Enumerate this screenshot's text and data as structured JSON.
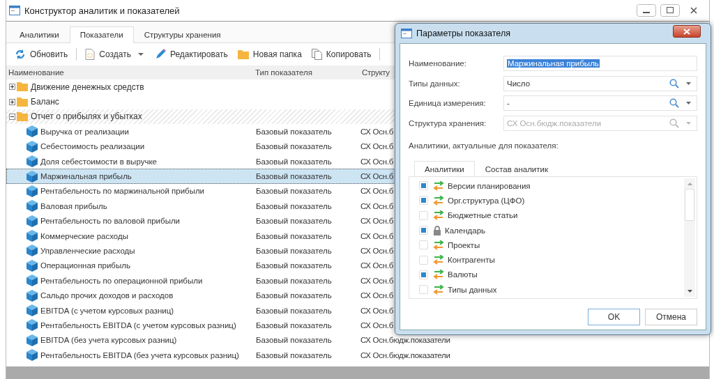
{
  "window": {
    "title": "Конструктор аналитик и показателей"
  },
  "tabs": [
    {
      "label": "Аналитики",
      "selected": false
    },
    {
      "label": "Показатели",
      "selected": true
    },
    {
      "label": "Структуры хранения",
      "selected": false
    }
  ],
  "toolbar": [
    {
      "kind": "refresh",
      "label": "Обновить"
    },
    {
      "kind": "create",
      "label": "Создать"
    },
    {
      "kind": "edit",
      "label": "Редактировать"
    },
    {
      "kind": "folder",
      "label": "Новая папка"
    },
    {
      "kind": "copy",
      "label": "Копировать"
    }
  ],
  "table": {
    "columns": [
      "Наименование",
      "Тип показателя",
      "Структу"
    ],
    "rows": [
      {
        "name": "Движение денежных средств",
        "expanded": false,
        "children": []
      },
      {
        "name": "Баланс",
        "expanded": false,
        "children": []
      },
      {
        "name": "Отчет о прибылях и убытках",
        "expanded": true,
        "children": [
          {
            "name": "Выручка от реализации",
            "type": "Базовый показатель",
            "structure": "СХ Осн.б",
            "selected": false
          },
          {
            "name": "Себестоимость реализации",
            "type": "Базовый показатель",
            "structure": "СХ Осн.б",
            "selected": false
          },
          {
            "name": "Доля себестоимости в выручке",
            "type": "Базовый показатель",
            "structure": "СХ Осн.б",
            "selected": false
          },
          {
            "name": "Маржинальная прибыль",
            "type": "Базовый показатель",
            "structure": "СХ Осн.б",
            "selected": true
          },
          {
            "name": "Рентабельность по маржинальной прибыли",
            "type": "Базовый показатель",
            "structure": "СХ Осн.б",
            "selected": false
          },
          {
            "name": "Валовая прибыль",
            "type": "Базовый показатель",
            "structure": "СХ Осн.б",
            "selected": false
          },
          {
            "name": "Рентабельность по валовой прибыли",
            "type": "Базовый показатель",
            "structure": "СХ Осн.б",
            "selected": false
          },
          {
            "name": "Коммерческие расходы",
            "type": "Базовый показатель",
            "structure": "СХ Осн.б",
            "selected": false
          },
          {
            "name": "Управленческие расходы",
            "type": "Базовый показатель",
            "structure": "СХ Осн.б",
            "selected": false
          },
          {
            "name": "Операционная прибыль",
            "type": "Базовый показатель",
            "structure": "СХ Осн.б",
            "selected": false
          },
          {
            "name": "Рентабельность по операционной прибыли",
            "type": "Базовый показатель",
            "structure": "СХ Осн.б",
            "selected": false
          },
          {
            "name": "Сальдо прочих доходов и расходов",
            "type": "Базовый показатель",
            "structure": "СХ Осн.б",
            "selected": false
          },
          {
            "name": "EBITDA (с учетом курсовых разниц)",
            "type": "Базовый показатель",
            "structure": "СХ Осн.б",
            "selected": false
          },
          {
            "name": "Рентабельность EBITDA (с учетом курсовых разниц)",
            "type": "Базовый показатель",
            "structure": "СХ Осн.б",
            "selected": false
          },
          {
            "name": "EBITDA (без учета курсовых разниц)",
            "type": "Базовый показатель",
            "structure": "СХ Осн.бюдж.показатели",
            "selected": false
          },
          {
            "name": "Рентабельность EBITDA (без учета курсовых разниц)",
            "type": "Базовый показатель",
            "structure": "СХ Осн.бюдж.показатели",
            "selected": false
          }
        ]
      }
    ]
  },
  "dialog": {
    "title": "Параметры показателя",
    "fields": [
      {
        "label": "Наименование:",
        "value": "Маржинальная прибыль",
        "kind": "text",
        "disabled": false
      },
      {
        "label": "Типы данных:",
        "value": "Число",
        "kind": "lookup",
        "disabled": false
      },
      {
        "label": "Единица измерения:",
        "value": "-",
        "kind": "lookup",
        "disabled": false
      },
      {
        "label": "Структура хранения:",
        "value": "СХ Осн.бюдж.показатели",
        "kind": "lookup",
        "disabled": true
      }
    ],
    "section_label": "Аналитики, актуальные для показателя:",
    "tabs": [
      {
        "label": "Аналитики",
        "selected": true
      },
      {
        "label": "Состав аналитик",
        "selected": false
      }
    ],
    "items": [
      {
        "label": "Версии планирования",
        "kind": "dimension",
        "checked": true
      },
      {
        "label": "Орг.структура (ЦФО)",
        "kind": "dimension",
        "checked": true
      },
      {
        "label": "Бюджетные статьи",
        "kind": "dimension",
        "checked": false
      },
      {
        "label": "Календарь",
        "kind": "locked",
        "checked": true
      },
      {
        "label": "Проекты",
        "kind": "dimension",
        "checked": false
      },
      {
        "label": "Контрагенты",
        "kind": "dimension",
        "checked": false
      },
      {
        "label": "Валюты",
        "kind": "dimension",
        "checked": true
      },
      {
        "label": "Типы данных",
        "kind": "dimension",
        "checked": false
      }
    ],
    "buttons": [
      {
        "label": "OK",
        "kind": "primary"
      },
      {
        "label": "Отмена",
        "kind": "secondary"
      }
    ]
  }
}
